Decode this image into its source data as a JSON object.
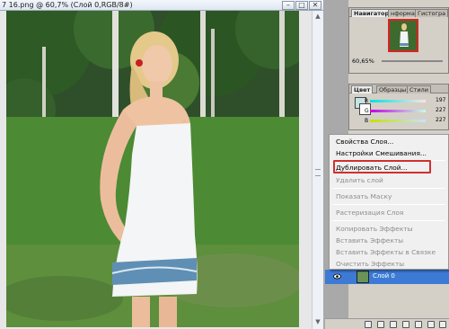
{
  "document": {
    "title": "7 16.png @ 60,7% (Слой 0,RGB/8#)",
    "btn_minimize": "–",
    "btn_maximize": "□",
    "btn_close": "✕"
  },
  "navigator_panel": {
    "tabs": [
      "Навигатор",
      "нформа",
      "Гистогра"
    ],
    "zoom": "60,65%"
  },
  "color_panel": {
    "tabs": [
      "Цвет",
      "Образцы",
      "Стили"
    ],
    "sliders": [
      {
        "label": "R",
        "value": "197"
      },
      {
        "label": "G",
        "value": "227"
      },
      {
        "label": "B",
        "value": "227"
      }
    ]
  },
  "context_menu": {
    "items": [
      {
        "label": "Свойства Слоя...",
        "enabled": true
      },
      {
        "label": "Настройки Смешивания...",
        "enabled": true
      },
      {
        "label": "Дублировать Слой...",
        "enabled": true,
        "highlighted": true
      },
      {
        "label": "Удалить слой",
        "enabled": false
      },
      {
        "label": "Показать Маску",
        "enabled": false
      },
      {
        "label": "Растеризация Слоя",
        "enabled": false
      },
      {
        "label": "Копировать Эффекты",
        "enabled": false
      },
      {
        "label": "Вставить Эффекты",
        "enabled": false
      },
      {
        "label": "Вставить Эффекты в Связке",
        "enabled": false
      },
      {
        "label": "Очистить Эффекты",
        "enabled": false
      }
    ]
  },
  "layers": {
    "active_layer": "Слой 0"
  },
  "colors": {
    "highlight_border": "#d03030",
    "selected_layer": "#3c7ad6"
  }
}
